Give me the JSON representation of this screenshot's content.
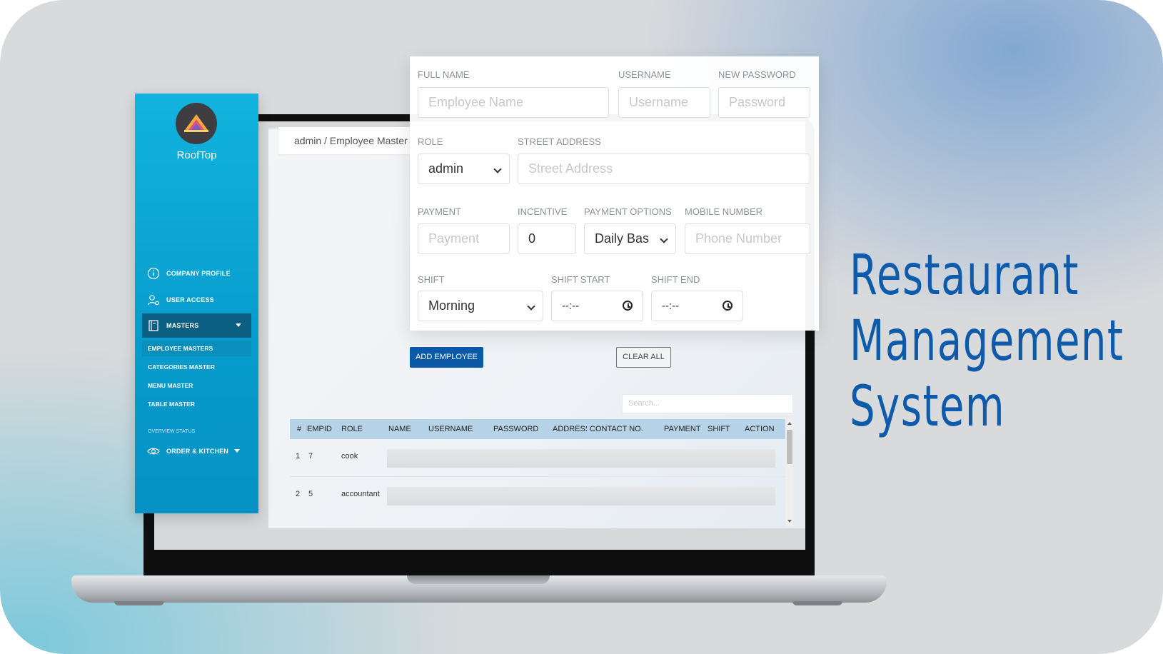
{
  "headline": [
    "Restaurant",
    "Management",
    "System"
  ],
  "breadcrumb": "admin / Employee Master",
  "sidebar": {
    "brand": "RoofTop",
    "items": [
      {
        "label": "COMPANY PROFILE",
        "icon": "info-icon"
      },
      {
        "label": "USER ACCESS",
        "icon": "user-gear-icon"
      },
      {
        "label": "MASTERS",
        "icon": "book-icon"
      }
    ],
    "sub_items": [
      "EMPLOYEE MASTERS",
      "CATEGORIES MASTER",
      "MENU MASTER",
      "TABLE MASTER"
    ],
    "section_label": "OVERVIEW STATUS",
    "order_item": {
      "label": "ORDER & KITCHEN",
      "icon": "eye-icon"
    }
  },
  "form": {
    "full_name": {
      "label": "FULL NAME",
      "placeholder": "Employee Name"
    },
    "username": {
      "label": "USERNAME",
      "placeholder": "Username"
    },
    "new_password": {
      "label": "NEW PASSWORD",
      "placeholder": "Password"
    },
    "role": {
      "label": "ROLE",
      "value": "admin"
    },
    "street_address": {
      "label": "STREET ADDRESS",
      "placeholder": "Street Address"
    },
    "payment": {
      "label": "PAYMENT",
      "placeholder": "Payment"
    },
    "incentive": {
      "label": "INCENTIVE",
      "value": "0"
    },
    "payment_options": {
      "label": "PAYMENT OPTIONS",
      "value": "Daily Bas"
    },
    "mobile_number": {
      "label": "MOBILE NUMBER",
      "placeholder": "Phone Number"
    },
    "shift": {
      "label": "SHIFT",
      "value": "Morning"
    },
    "shift_start": {
      "label": "SHIFT START",
      "value": "--:--"
    },
    "shift_end": {
      "label": "SHIFT END",
      "value": "--:--"
    }
  },
  "buttons": {
    "add": "ADD EMPLOYEE",
    "clear": "CLEAR ALL"
  },
  "search": {
    "placeholder": "Search..."
  },
  "table": {
    "headers": [
      "#",
      "EMPID",
      "ROLE",
      "NAME",
      "USERNAME",
      "PASSWORD",
      "ADDRESS",
      "CONTACT NO.",
      "PAYMENT",
      "SHIFT",
      "ACTION"
    ],
    "rows": [
      {
        "index": "1",
        "empid": "7",
        "role": "cook"
      },
      {
        "index": "2",
        "empid": "5",
        "role": "accountant"
      }
    ]
  },
  "colors": {
    "sidebar": "#0aa6d6",
    "primary_button": "#0a5aa8",
    "headline": "#0e5bab",
    "table_header": "#b7d3e8"
  }
}
